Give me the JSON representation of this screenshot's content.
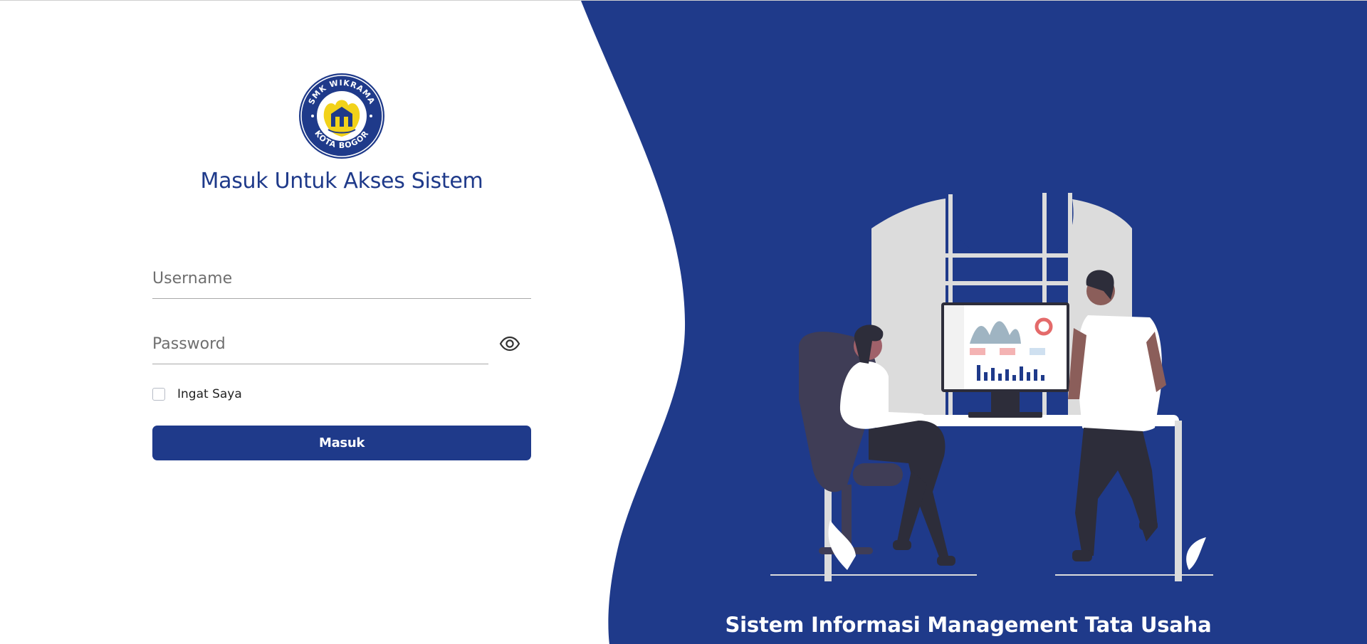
{
  "brand": {
    "logo_text_top": "SMK WIKRAMA",
    "logo_text_bottom": "KOTA BOGOR",
    "primary_color": "#1f3a8a",
    "logo_yellow": "#f2d21a"
  },
  "login": {
    "title": "Masuk Untuk Akses Sistem",
    "username_placeholder": "Username",
    "password_placeholder": "Password",
    "password_toggle_icon": "eye-icon",
    "remember_label": "Ingat Saya",
    "submit_label": "Masuk"
  },
  "hero": {
    "tagline": "Sistem Informasi Management Tata Usaha",
    "background_color": "#1f3a8a"
  }
}
